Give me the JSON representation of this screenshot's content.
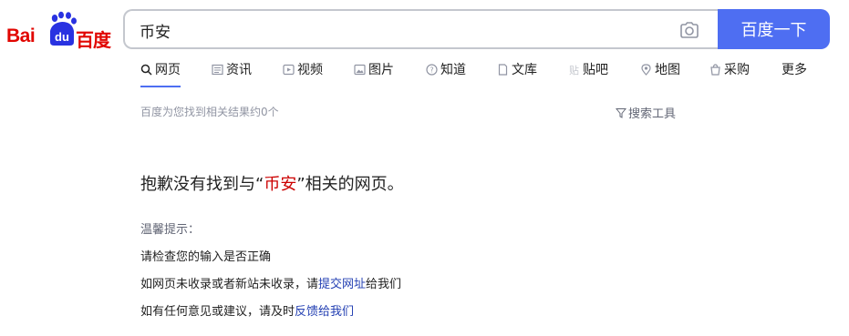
{
  "logo": {
    "text_bai": "Bai",
    "text_du": "du",
    "text_cn": "百度"
  },
  "search": {
    "value": "币安",
    "button_label": "百度一下"
  },
  "tabs": [
    {
      "label": "网页",
      "icon": "search-icon"
    },
    {
      "label": "资讯",
      "icon": "news-icon"
    },
    {
      "label": "视频",
      "icon": "video-icon"
    },
    {
      "label": "图片",
      "icon": "image-icon"
    },
    {
      "label": "知道",
      "icon": "question-icon"
    },
    {
      "label": "文库",
      "icon": "doc-icon"
    },
    {
      "label": "贴吧",
      "icon": "tieba-icon"
    },
    {
      "label": "地图",
      "icon": "map-icon"
    },
    {
      "label": "采购",
      "icon": "cart-icon"
    },
    {
      "label": "更多",
      "icon": ""
    }
  ],
  "result_count": "百度为您找到相关结果约0个",
  "search_tools": "搜索工具",
  "no_result": {
    "prefix": "抱歉没有找到与“",
    "keyword": "币安",
    "suffix": "”相关的网页。"
  },
  "tips": {
    "title": "温馨提示：",
    "tip1": "请检查您的输入是否正确",
    "tip2_prefix": "如网页未收录或者新站未收录，请",
    "tip2_link": "提交网址",
    "tip2_suffix": "给我们",
    "tip3_prefix": "如有任何意见或建议，请及时",
    "tip3_link": "反馈给我们"
  },
  "colors": {
    "brand_red": "#e10601",
    "brand_blue": "#4e6ef2",
    "link": "#2440b3",
    "keyword": "#cc0000"
  }
}
